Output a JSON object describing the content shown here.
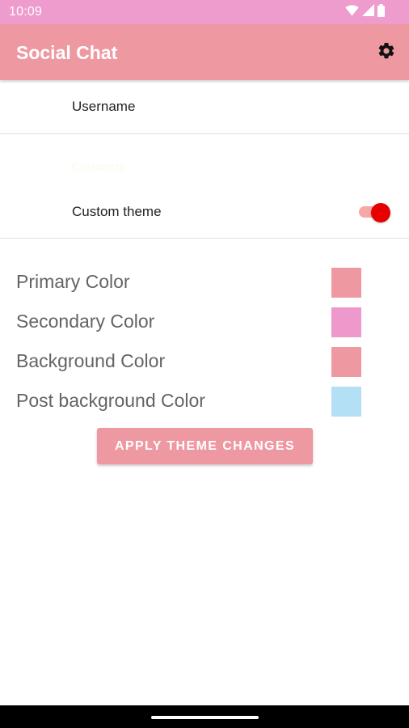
{
  "status_bar": {
    "time": "10:09",
    "color": "#ee9bcd",
    "icons": [
      "wifi-icon",
      "signal-icon",
      "battery-icon"
    ]
  },
  "app_bar": {
    "title": "Social Chat",
    "color": "#ee98a1",
    "action_icon": "settings-gear-icon"
  },
  "preferences": {
    "username_label": "Username",
    "category_label": "Customize",
    "custom_theme_label": "Custom theme",
    "custom_theme_enabled": true,
    "switch_colors": {
      "thumb": "#e80000",
      "track": "#f6a7a7"
    }
  },
  "colors": [
    {
      "label": "Primary Color",
      "value": "#ee98a1"
    },
    {
      "label": "Secondary Color",
      "value": "#ee98cc"
    },
    {
      "label": "Background Color",
      "value": "#ee98a1"
    },
    {
      "label": "Post background Color",
      "value": "#b3e0f4"
    }
  ],
  "apply_button": {
    "label": "APPLY THEME CHANGES",
    "color": "#ee98a1"
  }
}
